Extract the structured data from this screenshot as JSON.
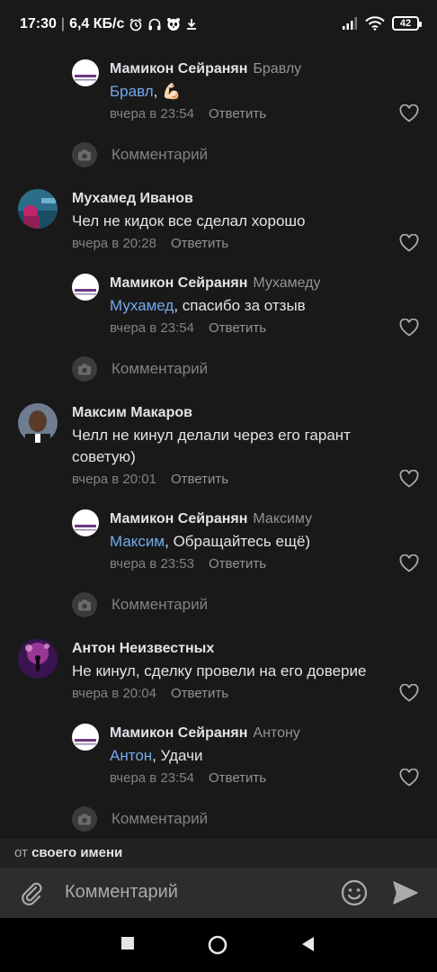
{
  "status_bar": {
    "time": "17:30",
    "network_speed": "6,4 КБ/с",
    "battery": "42",
    "icons": [
      "alarm-icon",
      "headphones-icon",
      "panda-icon",
      "download-icon",
      "signal-icon",
      "wifi-icon",
      "battery-icon"
    ]
  },
  "comments": [
    {
      "name": "Мамикон Сейранян",
      "to": "Бравлу",
      "mention": "Бравл",
      "text": ", 💪🏻",
      "time": "вчера в 23:54",
      "reply": "Ответить",
      "is_reply": true
    },
    {
      "name": "Мухамед Иванов",
      "to": "",
      "mention": "",
      "text": "Чел не кидок все сделал хорошо",
      "time": "вчера в 20:28",
      "reply": "Ответить",
      "is_reply": false
    },
    {
      "name": "Мамикон Сейранян",
      "to": "Мухамеду",
      "mention": "Мухамед",
      "text": ", спасибо за отзыв",
      "time": "вчера в 23:54",
      "reply": "Ответить",
      "is_reply": true
    },
    {
      "name": "Максим Макаров",
      "to": "",
      "mention": "",
      "text": "Челл не кинул делали через его гарант советую)",
      "time": "вчера в 20:01",
      "reply": "Ответить",
      "is_reply": false
    },
    {
      "name": "Мамикон Сейранян",
      "to": "Максиму",
      "mention": "Максим",
      "text": ", Обращайтесь ещё)",
      "time": "вчера в 23:53",
      "reply": "Ответить",
      "is_reply": true
    },
    {
      "name": "Антон Неизвестных",
      "to": "",
      "mention": "",
      "text": "Не кинул, сделку провели на его доверие",
      "time": "вчера в 20:04",
      "reply": "Ответить",
      "is_reply": false
    },
    {
      "name": "Мамикон Сейранян",
      "to": "Антону",
      "mention": "Антон",
      "text": ", Удачи",
      "time": "вчера в 23:54",
      "reply": "Ответить",
      "is_reply": true
    }
  ],
  "comment_prompt": "Комментарий",
  "from_bar": {
    "prefix": "от",
    "value": "своего имени"
  },
  "composer": {
    "placeholder": "Комментарий"
  },
  "colors": {
    "background": "#19191a",
    "mention": "#71aaeb",
    "muted": "#828282",
    "text": "#e1e3e6"
  }
}
